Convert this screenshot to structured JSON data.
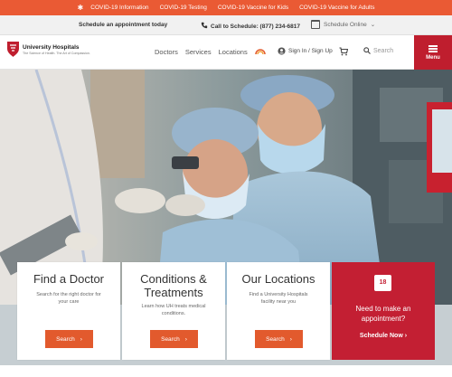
{
  "covid_bar": {
    "items": [
      "COVID-19 Information",
      "COVID-19 Testing",
      "COVID-19 Vaccine for Kids",
      "COVID-19 Vaccine for Adults"
    ]
  },
  "utility": {
    "appointment": "Schedule an appointment today",
    "call": "Call to Schedule: (877) 234-6817",
    "schedule_online": "Schedule Online"
  },
  "header": {
    "brand": "University Hospitals",
    "tagline": "The Science of Health. The Art of Compassion.",
    "nav": [
      "Doctors",
      "Services",
      "Locations"
    ],
    "sign_in": "Sign In / Sign Up",
    "search_placeholder": "Search",
    "menu_label": "Menu"
  },
  "cards": [
    {
      "title": "Find a Doctor",
      "desc": "Search for the right doctor for your care",
      "button": "Search"
    },
    {
      "title": "Conditions & Treatments",
      "desc": "Learn how UH treats medical conditions.",
      "button": "Search"
    },
    {
      "title": "Our Locations",
      "desc": "Find a University Hospitals facility near you",
      "button": "Search"
    }
  ],
  "appointment_card": {
    "calendar_day": "18",
    "text": "Need to make an appointment?",
    "button": "Schedule Now"
  },
  "colors": {
    "covid_bar": "#ea5a34",
    "brand_red": "#bf1e2e",
    "button_orange": "#e25a2d"
  }
}
